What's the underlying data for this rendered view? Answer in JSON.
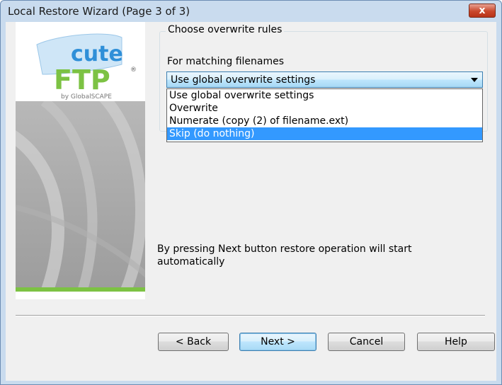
{
  "window": {
    "title": "Local Restore Wizard (Page 3 of 3)",
    "close_label": "x"
  },
  "logo": {
    "text_cute": "cute",
    "text_ftp": "FTP",
    "registered": "®",
    "byline": "by GlobalSCAPE"
  },
  "group": {
    "label": "Choose overwrite rules",
    "matching_label": "For matching filenames"
  },
  "overwrite_select": {
    "selected_value": "Use global overwrite settings",
    "options": [
      "Use global overwrite settings",
      "Overwrite",
      "Numerate (copy (2) of filename.ext)",
      "Skip (do nothing)"
    ],
    "highlighted_option": "Skip (do nothing)"
  },
  "note": "By pressing Next button restore operation will start automatically",
  "buttons": {
    "back": "< Back",
    "next": "Next >",
    "cancel": "Cancel",
    "help": "Help"
  },
  "colors": {
    "logo_green": "#7cc243",
    "logo_blue": "#2f8fd8",
    "highlight": "#3399ff"
  }
}
